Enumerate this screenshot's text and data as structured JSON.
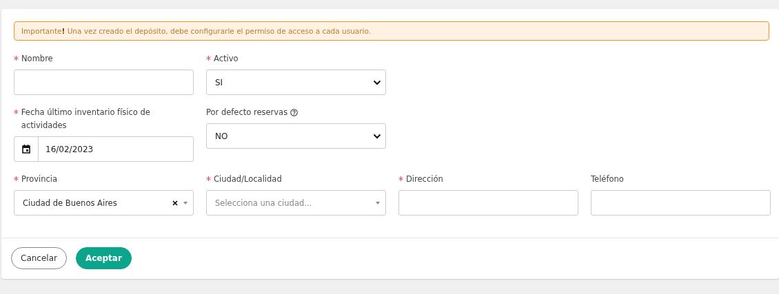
{
  "alert": {
    "text": "Importante**!** Una vez creado el depósito, debe configurarle el permiso de acceso a cada usuario."
  },
  "rows": [
    [
      {
        "kind": "text",
        "label": "Nombre",
        "required": true
      },
      {
        "kind": "select",
        "label": "Activo",
        "required": true,
        "value": "SI"
      }
    ],
    [
      {
        "kind": "date",
        "label": "Fecha último inventario físico de actividades",
        "required": true,
        "value": "16/02/2023"
      },
      {
        "kind": "select",
        "label": "Por defecto reservas",
        "required": false,
        "help": true,
        "value": "NO"
      }
    ],
    [
      {
        "kind": "combo",
        "label": "Provincia",
        "required": true,
        "value": "Ciudad de Buenos Aires",
        "clearable": true
      },
      {
        "kind": "combo",
        "label": "Ciudad/Localidad",
        "required": true,
        "placeholder": "Selecciona una ciudad..."
      },
      {
        "kind": "text",
        "label": "Dirección",
        "required": true
      },
      {
        "kind": "text",
        "label": "Teléfono",
        "required": false
      }
    ]
  ],
  "buttons": [
    {
      "label": "Cancelar",
      "kind": "secondary"
    },
    {
      "label": "Aceptar",
      "kind": "primary"
    }
  ]
}
